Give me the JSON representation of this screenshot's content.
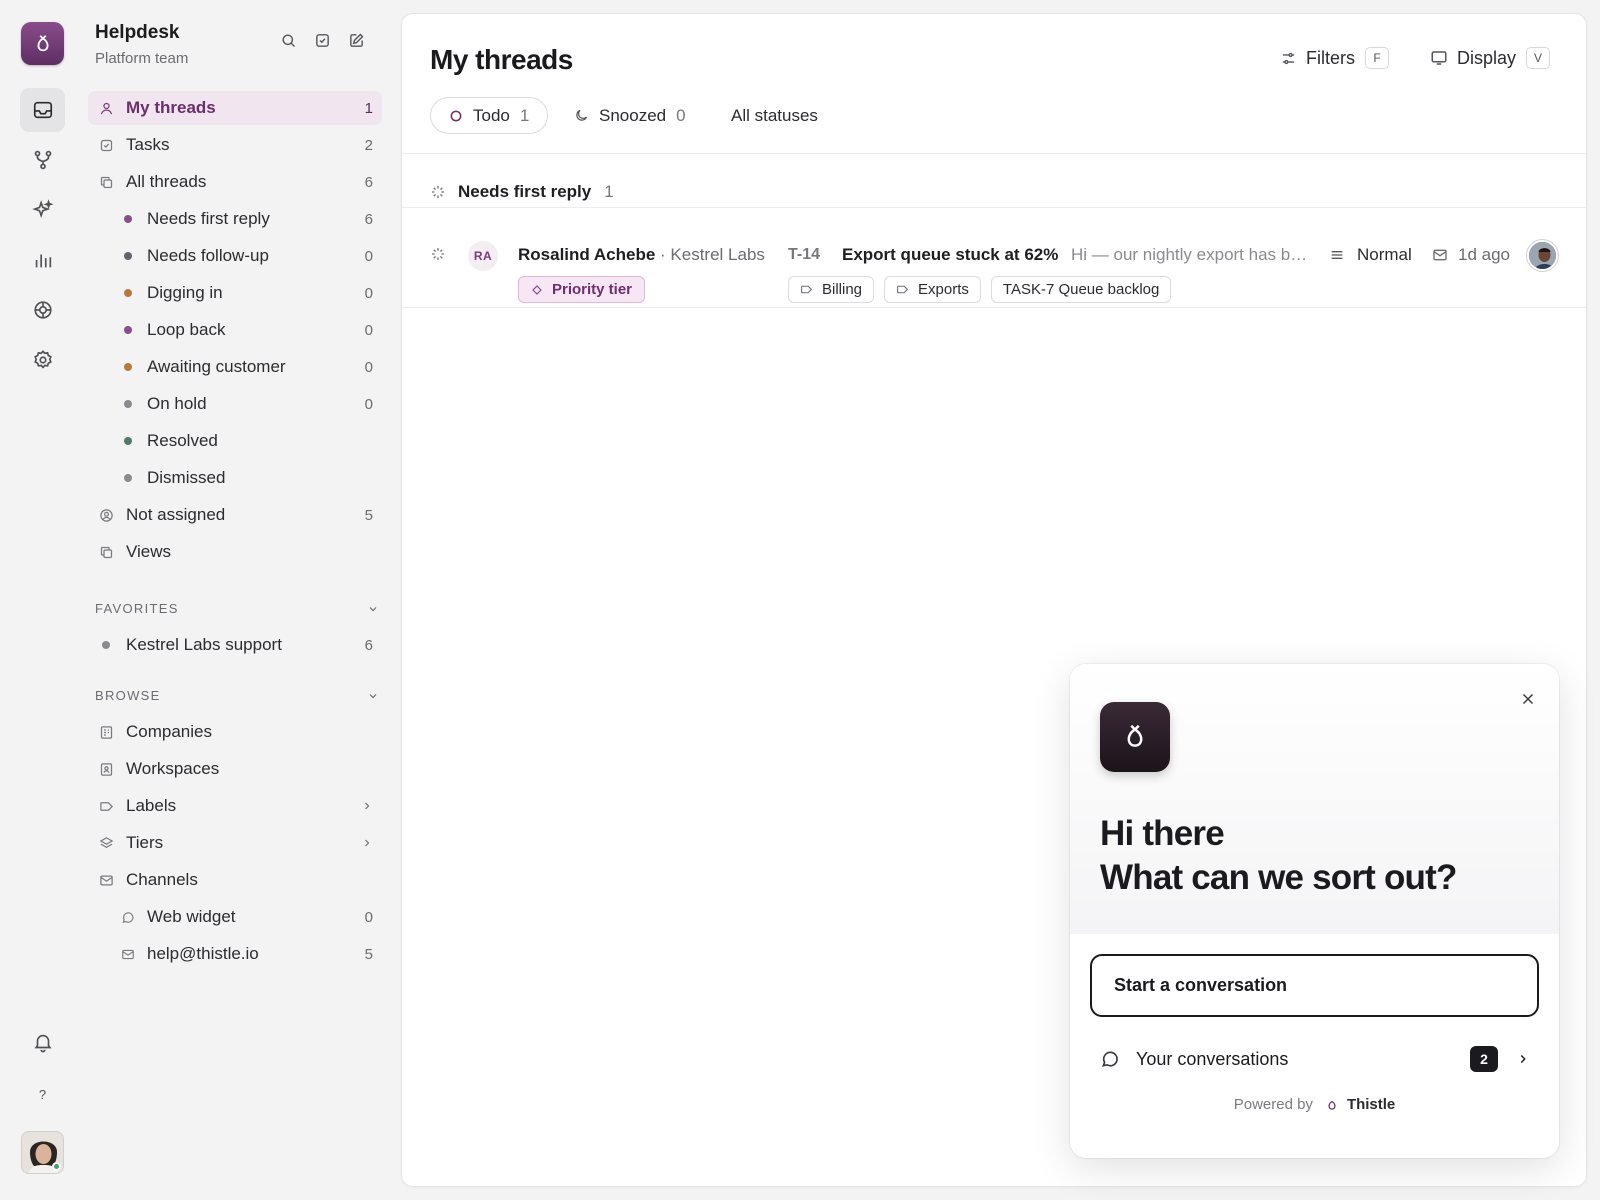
{
  "workspace": {
    "name": "Helpdesk",
    "team": "Platform team"
  },
  "colors": {
    "accent": "#6e2f6f",
    "accent_bg": "#f1e6ef"
  },
  "nav": {
    "my_threads": {
      "label": "My threads",
      "count": "1"
    },
    "tasks": {
      "label": "Tasks",
      "count": "2"
    },
    "all_threads": {
      "label": "All threads",
      "count": "6"
    },
    "statuses": [
      {
        "label": "Needs first reply",
        "count": "6",
        "color": "#8a4c8c"
      },
      {
        "label": "Needs follow-up",
        "count": "0",
        "color": "#5f6670"
      },
      {
        "label": "Digging in",
        "count": "0",
        "color": "#b9783d"
      },
      {
        "label": "Loop back",
        "count": "0",
        "color": "#8a4c8c"
      },
      {
        "label": "Awaiting customer",
        "count": "0",
        "color": "#b9783d"
      },
      {
        "label": "On hold",
        "count": "0",
        "color": "#8a8a90"
      },
      {
        "label": "Resolved",
        "count": "",
        "color": "#4f7a66"
      },
      {
        "label": "Dismissed",
        "count": "",
        "color": "#8a8a90"
      }
    ],
    "not_assigned": {
      "label": "Not assigned",
      "count": "5"
    },
    "views": {
      "label": "Views"
    }
  },
  "favorites": {
    "heading": "FAVORITES",
    "items": [
      {
        "label": "Kestrel Labs support",
        "count": "6"
      }
    ]
  },
  "browse": {
    "heading": "BROWSE",
    "companies": "Companies",
    "workspaces": "Workspaces",
    "labels": "Labels",
    "tiers": "Tiers",
    "channels": "Channels",
    "channel_items": [
      {
        "label": "Web widget",
        "count": "0"
      },
      {
        "label": "help@thistle.io",
        "count": "5"
      }
    ]
  },
  "rail": {
    "help": "?"
  },
  "main": {
    "title": "My threads",
    "filters": {
      "label": "Filters",
      "key": "F"
    },
    "display": {
      "label": "Display",
      "key": "V"
    },
    "tabs": [
      {
        "label": "Todo",
        "count": "1"
      },
      {
        "label": "Snoozed",
        "count": "0"
      },
      {
        "label": "All statuses",
        "count": ""
      }
    ],
    "group": {
      "label": "Needs first reply",
      "count": "1"
    },
    "thread": {
      "initials": "RA",
      "customer": "Rosalind Achebe",
      "company": "· Kestrel Labs",
      "tier": "Priority tier",
      "id": "T-14",
      "subject": "Export queue stuck at 62%",
      "preview": "Hi — our nightly export has been stuck",
      "priority": "Normal",
      "age": "1d ago",
      "labels": [
        "Billing",
        "Exports"
      ],
      "task": "TASK-7 Queue backlog"
    }
  },
  "widget": {
    "greeting_line1": "Hi there",
    "greeting_line2": "What can we sort out?",
    "start_label": "Start a conversation",
    "conversations_label": "Your conversations",
    "conversations_count": "2",
    "powered_by": "Powered by",
    "brand": "Thistle"
  }
}
